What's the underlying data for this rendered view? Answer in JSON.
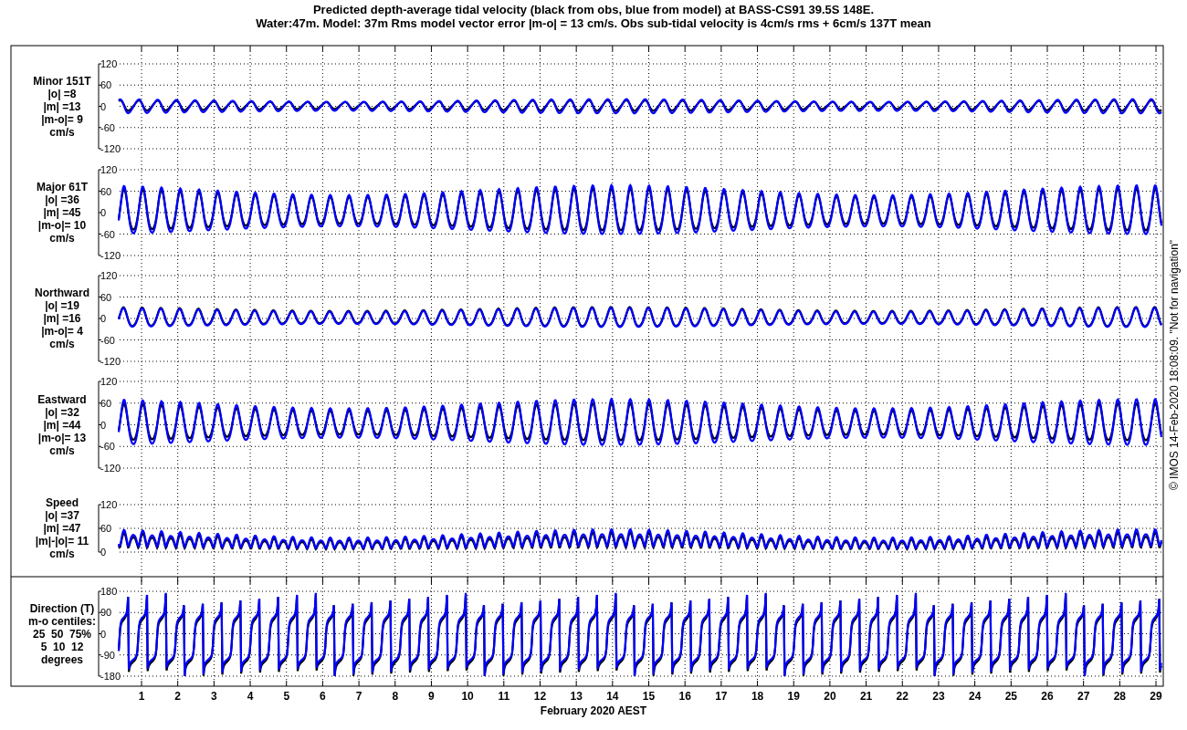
{
  "title_lines": [
    "Predicted depth-average tidal velocity (black from obs, blue from model) at BASS-CS91 39.5S 148E.",
    "Water:47m. Model: 37m  Rms model vector error |m-o| = 13 cm/s. Obs sub-tidal velocity is 4cm/s rms + 6cm/s 137T mean"
  ],
  "panels": [
    {
      "kind": "velocity",
      "label_lines": [
        "Minor 151T",
        "|o| =8",
        "|m| =13",
        "|m-o|= 9",
        "cm/s"
      ],
      "yticks": [
        "120",
        "60",
        "0",
        "-60",
        "-120"
      ]
    },
    {
      "kind": "velocity",
      "label_lines": [
        "Major 61T",
        "|o| =36",
        "|m| =45",
        "|m-o|= 10",
        "cm/s"
      ],
      "yticks": [
        "120",
        "60",
        "0",
        "-60",
        "-120"
      ]
    },
    {
      "kind": "velocity",
      "label_lines": [
        "Northward",
        "|o| =19",
        "|m| =16",
        "|m-o|= 4",
        "cm/s"
      ],
      "yticks": [
        "120",
        "60",
        "0",
        "-60",
        "-120"
      ]
    },
    {
      "kind": "velocity",
      "label_lines": [
        "Eastward",
        "|o| =32",
        "|m| =44",
        "|m-o|= 13",
        "cm/s"
      ],
      "yticks": [
        "120",
        "60",
        "0",
        "-60",
        "-120"
      ]
    },
    {
      "kind": "speed",
      "label_lines": [
        "Speed",
        "|o| =37",
        "|m| =47",
        "|m|-|o|= 11",
        "cm/s"
      ],
      "yticks": [
        "120",
        "60",
        "0"
      ]
    },
    {
      "kind": "direction",
      "label_lines": [
        "Direction (T)",
        "m-o centiles:",
        "25  50  75%",
        "5  10  12",
        "degrees"
      ],
      "yticks": [
        "180",
        "90",
        "0",
        "-90",
        "-180"
      ]
    }
  ],
  "xticks": [
    "1",
    "2",
    "3",
    "4",
    "5",
    "6",
    "7",
    "8",
    "9",
    "10",
    "11",
    "12",
    "13",
    "14",
    "15",
    "16",
    "17",
    "18",
    "19",
    "20",
    "21",
    "22",
    "23",
    "24",
    "25",
    "26",
    "27",
    "28",
    "29"
  ],
  "xlabel": "February 2020 AEST",
  "footer": "© IMOS 14-Feb-2020 18:08:09. \"Not for navigation\""
}
